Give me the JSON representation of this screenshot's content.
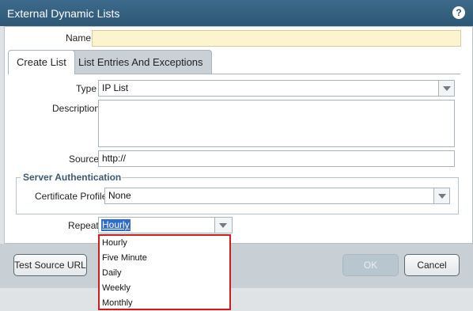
{
  "dialog": {
    "title": "External Dynamic Lists",
    "help_glyph": "?"
  },
  "form": {
    "name_label": "Name",
    "name_value": "",
    "tabs": [
      {
        "label": "Create List",
        "active": true
      },
      {
        "label": "List Entries And Exceptions",
        "active": false
      }
    ],
    "type_label": "Type",
    "type_value": "IP List",
    "description_label": "Description",
    "description_value": "",
    "source_label": "Source",
    "source_value": "http://",
    "server_auth": {
      "legend": "Server Authentication",
      "cert_profile_label": "Certificate Profile",
      "cert_profile_value": "None"
    },
    "repeat_label": "Repeat",
    "repeat_value": "Hourly",
    "repeat_options": [
      "Hourly",
      "Five Minute",
      "Daily",
      "Weekly",
      "Monthly"
    ]
  },
  "buttons": {
    "test_source": "Test Source URL",
    "ok": "OK",
    "cancel": "Cancel"
  },
  "colors": {
    "titlebar": "#2d5775",
    "name_field_bg": "#fcf3cf",
    "selection_highlight": "#2f6bd1",
    "dropdown_border": "#d11a1a"
  }
}
